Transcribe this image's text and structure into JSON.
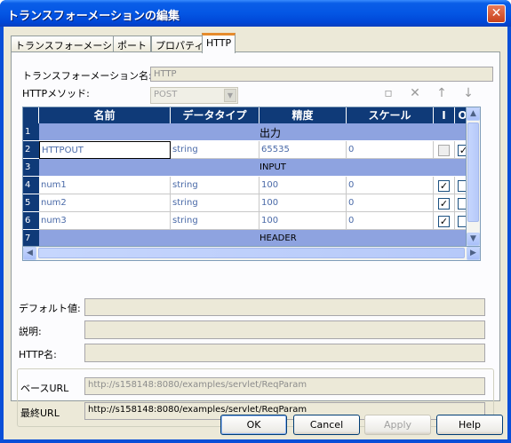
{
  "window": {
    "title": "トランスフォーメーションの編集",
    "close": "✕"
  },
  "tabs": [
    "トランスフォーメーション",
    "ポート",
    "プロパティ",
    "HTTP"
  ],
  "form": {
    "name_label": "トランスフォーメーション名:",
    "name_value": "HTTP",
    "method_label": "HTTPメソッド:",
    "method_value": "POST"
  },
  "grid": {
    "columns": [
      "名前",
      "データタイプ",
      "精度",
      "スケール",
      "I",
      "O"
    ],
    "rows": [
      {
        "num": "1",
        "group": "出力"
      },
      {
        "num": "2",
        "name": "HTTPOUT",
        "type": "string",
        "precision": "65535",
        "scale": "0",
        "i": false,
        "o": true
      },
      {
        "num": "3",
        "group": "INPUT"
      },
      {
        "num": "4",
        "name": "num1",
        "type": "string",
        "precision": "100",
        "scale": "0",
        "i": true,
        "o": false
      },
      {
        "num": "5",
        "name": "num2",
        "type": "string",
        "precision": "100",
        "scale": "0",
        "i": true,
        "o": false
      },
      {
        "num": "6",
        "name": "num3",
        "type": "string",
        "precision": "100",
        "scale": "0",
        "i": true,
        "o": false
      },
      {
        "num": "7",
        "group": "HEADER"
      }
    ]
  },
  "fields": {
    "default_label": "デフォルト値:",
    "description_label": "説明:",
    "http_name_label": "HTTP名:",
    "base_url_label": "ベースURL",
    "base_url_value": "http://s158148:8080/examples/servlet/ReqParam",
    "final_url_label": "最終URL",
    "final_url_value": "http://s158148:8080/examples/servlet/ReqParam"
  },
  "buttons": {
    "ok": "OK",
    "cancel": "Cancel",
    "apply": "Apply",
    "help": "Help"
  }
}
